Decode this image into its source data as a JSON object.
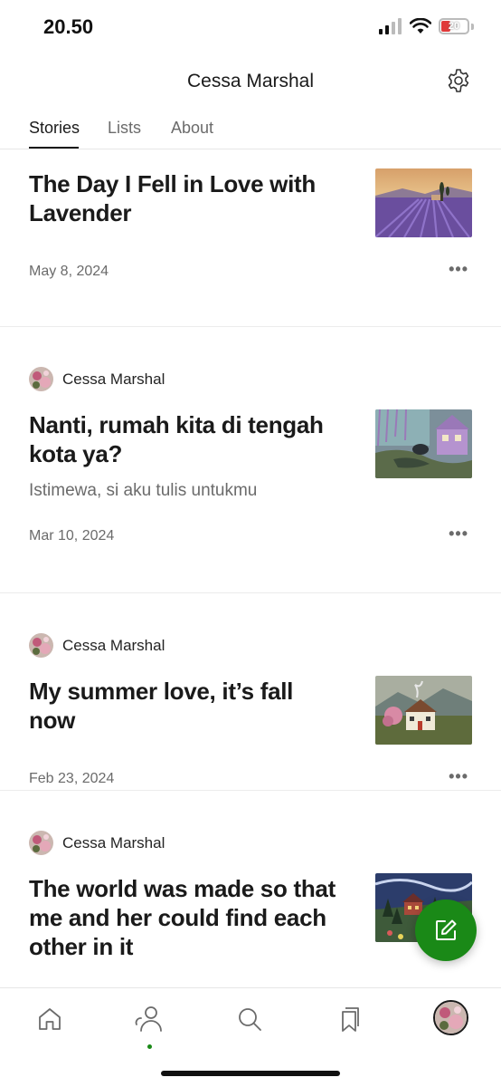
{
  "status_bar": {
    "time": "20.50",
    "battery": "20"
  },
  "header": {
    "title": "Cessa Marshal",
    "settings_icon": "gear-icon"
  },
  "tabs": [
    {
      "label": "Stories",
      "active": true
    },
    {
      "label": "Lists",
      "active": false
    },
    {
      "label": "About",
      "active": false
    }
  ],
  "stories": [
    {
      "author": "",
      "title": "The Day I Fell in Love with Lavender",
      "subtitle": "",
      "date": "May 8, 2024",
      "more": "•••"
    },
    {
      "author": "Cessa Marshal",
      "title": "Nanti, rumah kita di tengah kota ya?",
      "subtitle": "Istimewa, si aku tulis untukmu",
      "date": "Mar 10, 2024",
      "more": "•••"
    },
    {
      "author": "Cessa Marshal",
      "title": "My summer love, it’s fall now",
      "subtitle": "",
      "date": "Feb 23, 2024",
      "more": "•••"
    },
    {
      "author": "Cessa Marshal",
      "title": "The world was made so that me and her could find each other in it",
      "subtitle": "",
      "date": "",
      "more": ""
    }
  ],
  "fab_icon": "edit-icon",
  "bottom_nav": [
    "home-icon",
    "following-icon",
    "search-icon",
    "bookmarks-icon",
    "profile-avatar"
  ],
  "colors": {
    "accent": "#1a8917",
    "text": "#1a1a1a",
    "muted": "#6b6b6b"
  }
}
